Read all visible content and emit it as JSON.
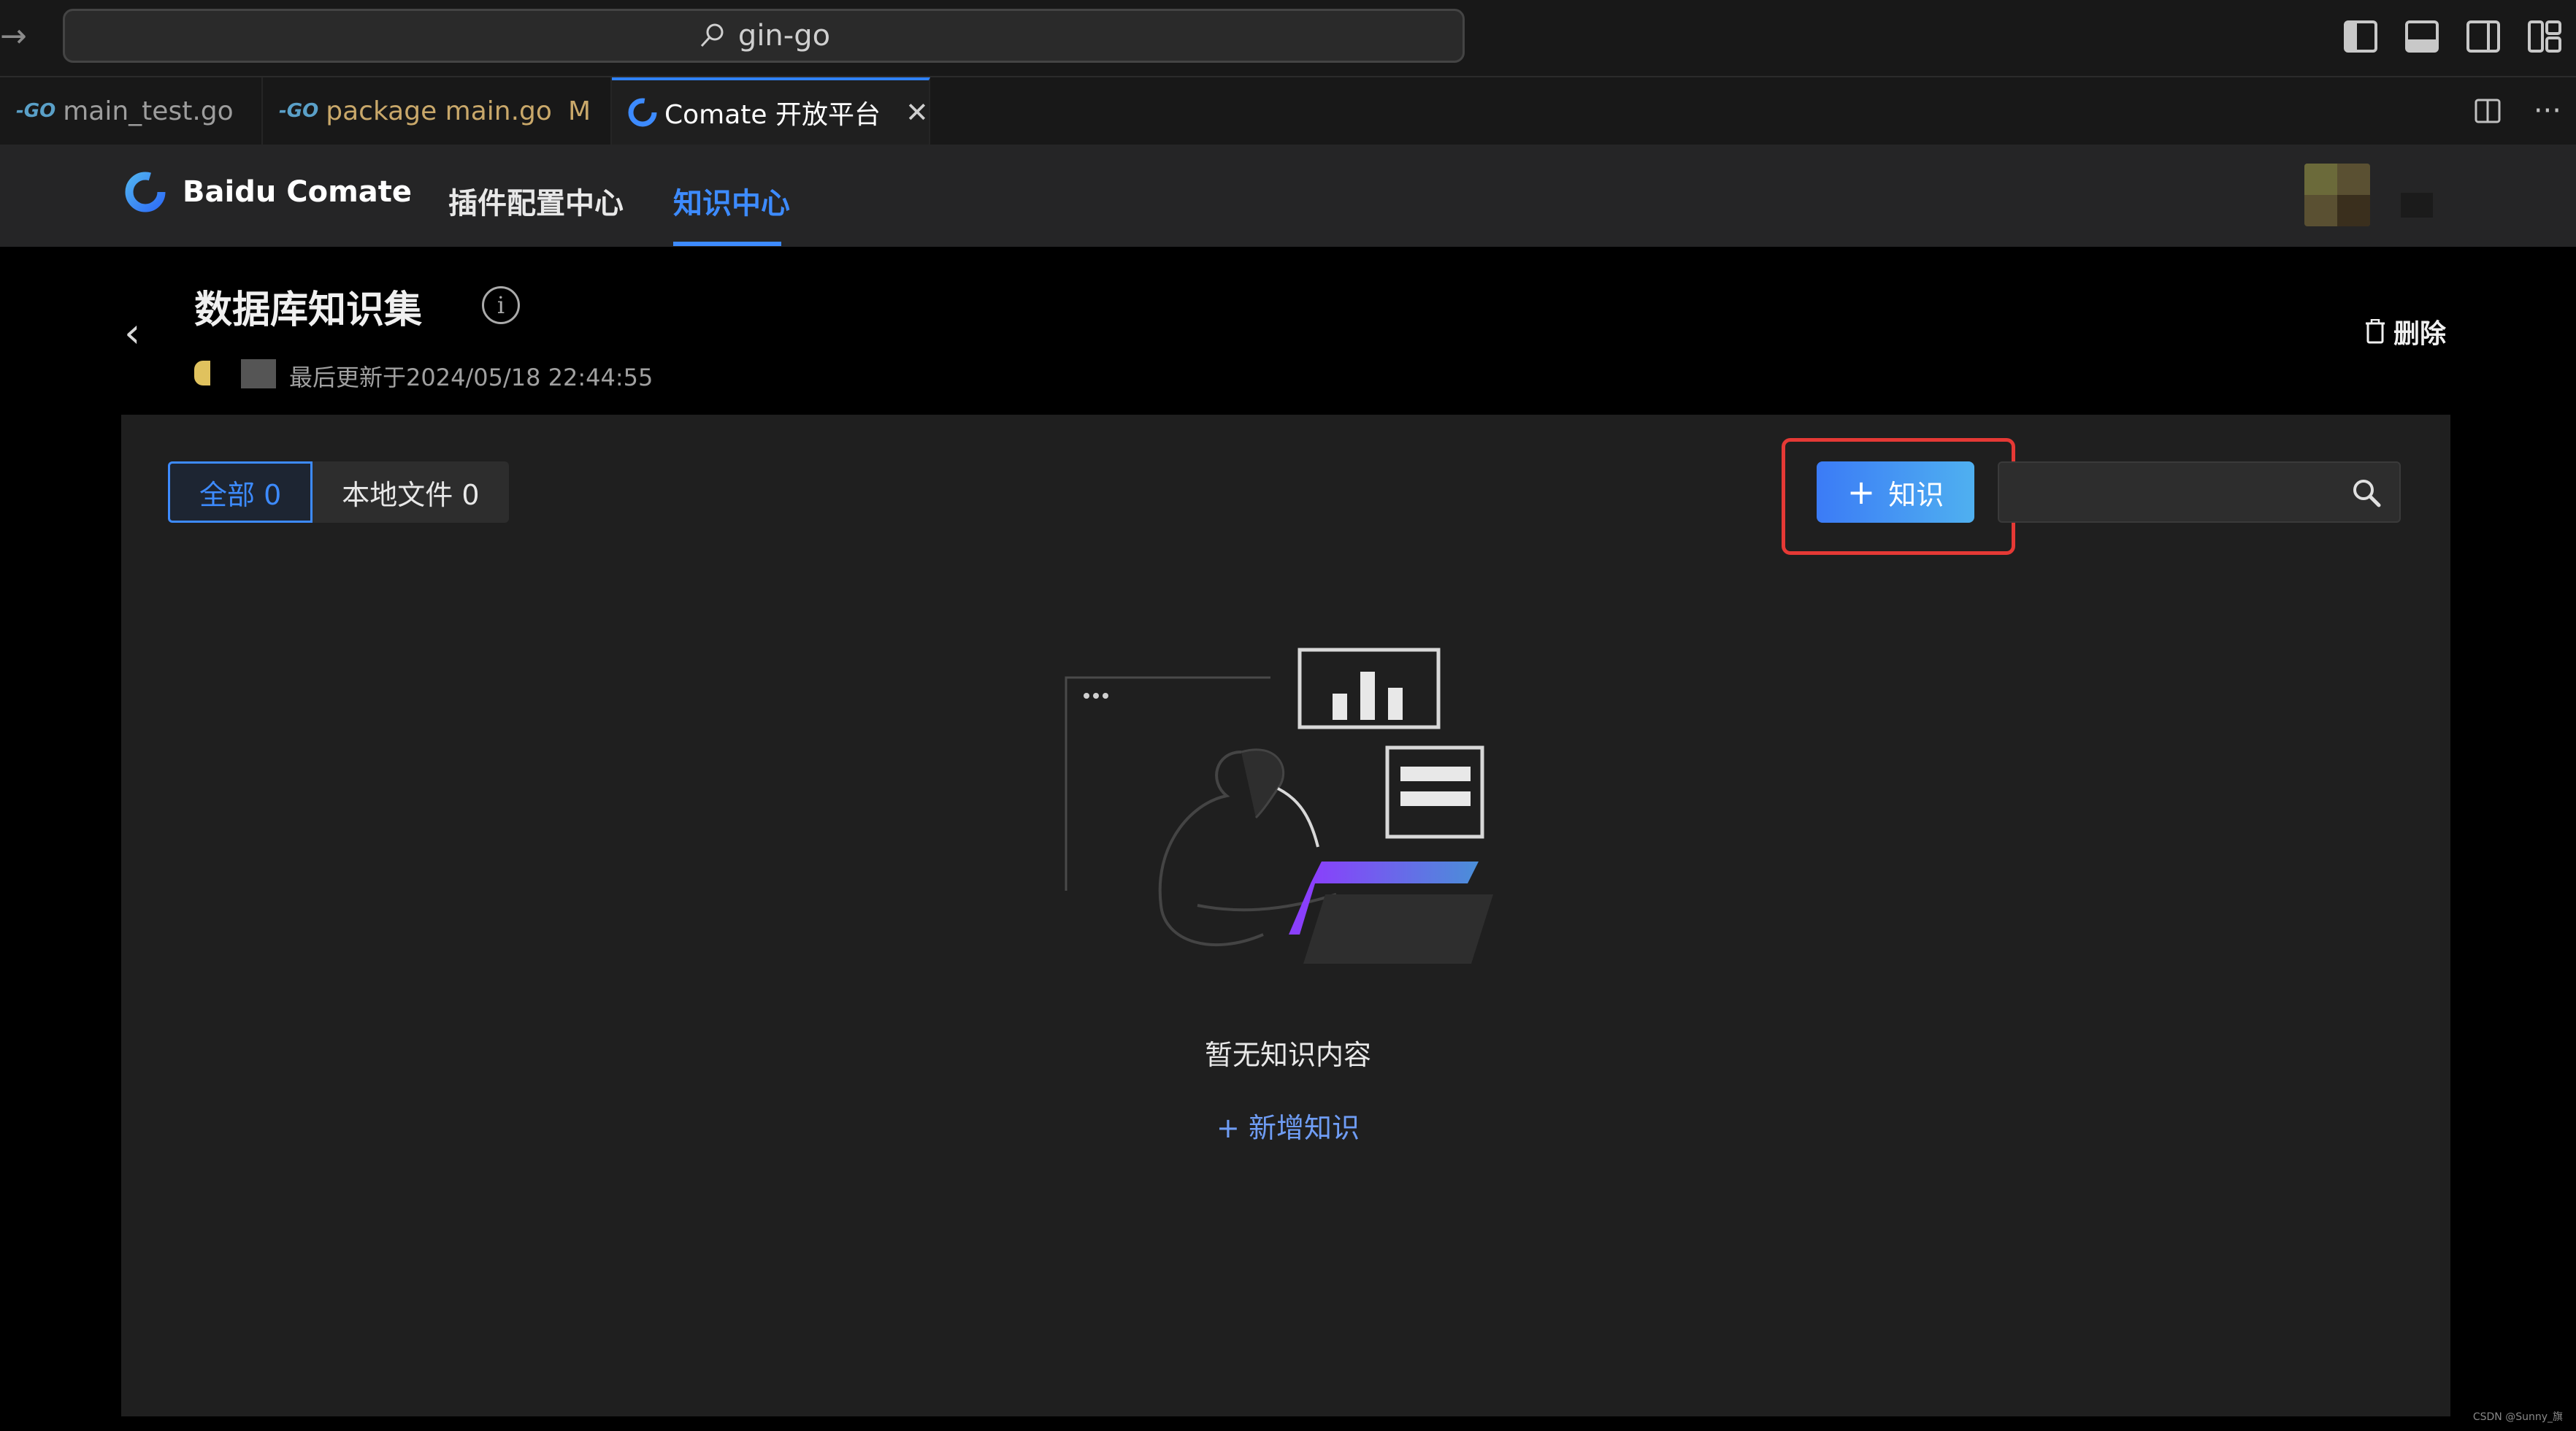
{
  "window": {
    "command_center": "gin-go"
  },
  "tabs": [
    {
      "prefix": "-GO",
      "label": "main_test.go"
    },
    {
      "prefix": "-GO",
      "label": "package main.go",
      "status": "M"
    },
    {
      "label": "Comate 开放平台",
      "active": true
    }
  ],
  "app": {
    "brand": "Baidu Comate",
    "nav": [
      "插件配置中心",
      "知识中心"
    ],
    "active_nav": "知识中心"
  },
  "page": {
    "title": "数据库知识集",
    "meta": "最后更新于2024/05/18 22:44:55",
    "delete_label": "删除"
  },
  "filters": [
    {
      "label": "全部 0",
      "active": true
    },
    {
      "label": "本地文件 0",
      "active": false
    }
  ],
  "toolbar": {
    "add_label": "知识",
    "search_placeholder": "",
    "highlight_color": "#e53935",
    "accent_color": "#3d8bff"
  },
  "empty": {
    "text": "暂无知识内容",
    "add_label": "+ 新增知识"
  },
  "watermark": "CSDN @Sunny_旗"
}
